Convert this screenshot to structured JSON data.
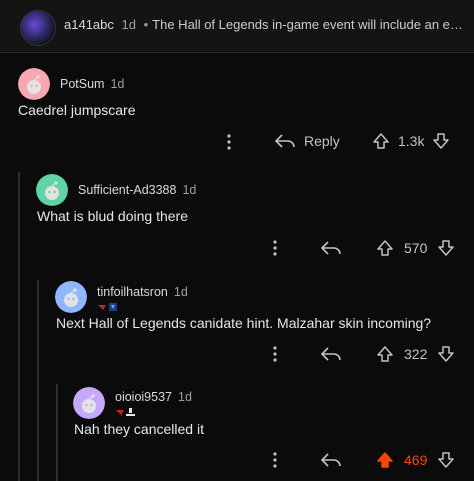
{
  "header": {
    "username": "a141abc",
    "time": "1d",
    "bullet": "•",
    "title": "The Hall of Legends in-game event will include an event pa..."
  },
  "comments": [
    {
      "username": "PotSum",
      "time": "1d",
      "text": "Caedrel jumpscare",
      "reply_label": "Reply",
      "score": "1.3k",
      "upvoted": false,
      "avatar_color": "#f7a8b0"
    },
    {
      "username": "Sufficient-Ad3388",
      "time": "1d",
      "text": "What is blud doing there",
      "score": "570",
      "upvoted": false,
      "avatar_color": "#5fd3a6"
    },
    {
      "username": "tinfoilhatsron",
      "time": "1d",
      "text": "Next Hall of Legends canidate hint. Malzahar skin incoming?",
      "score": "322",
      "upvoted": false,
      "avatar_color": "#8fb6ff"
    },
    {
      "username": "oioioi9537",
      "time": "1d",
      "text": "Nah they cancelled it",
      "score": "469",
      "upvoted": true,
      "avatar_color": "#c7a8ff"
    }
  ],
  "icons": {
    "more": "more-options-icon",
    "reply": "reply-arrow-icon",
    "upvote": "upvote-icon",
    "downvote": "downvote-icon"
  },
  "colors": {
    "upvoted": "#ff4500",
    "background": "#0b0b0b"
  }
}
